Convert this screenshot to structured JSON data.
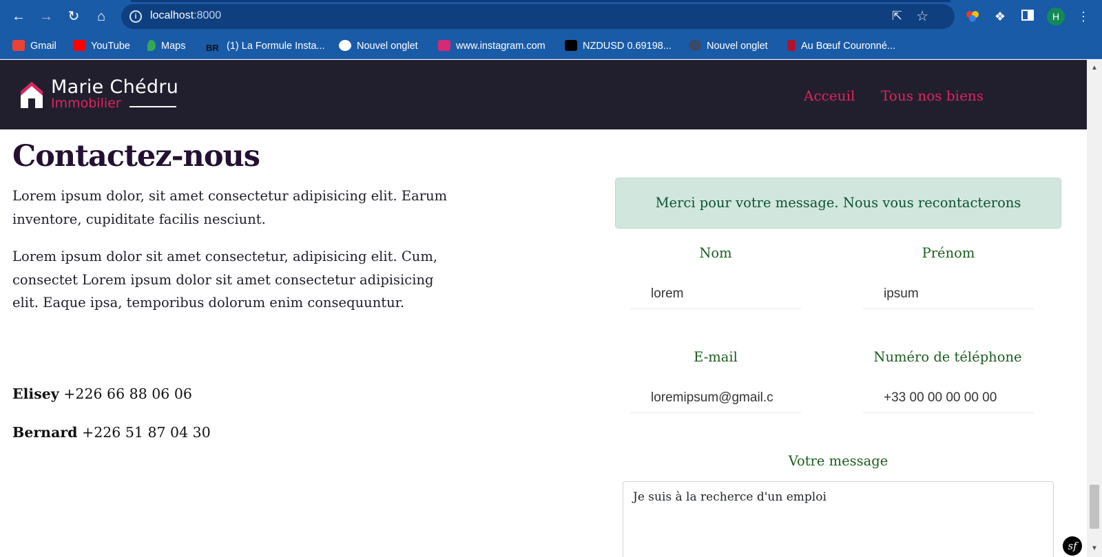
{
  "browser": {
    "url_host": "localhost",
    "url_port": ":8000",
    "profile_initial": "H",
    "bookmarks": [
      {
        "label": "Gmail",
        "icon": "gmail-icon",
        "color": "#ea4335"
      },
      {
        "label": "YouTube",
        "icon": "youtube-icon",
        "color": "#ff0000"
      },
      {
        "label": "Maps",
        "icon": "maps-icon",
        "color": "#34a853"
      },
      {
        "label": "(1) La Formule Insta...",
        "icon": "br-icon",
        "color": "#111111"
      },
      {
        "label": "Nouvel onglet",
        "icon": "globe-icon",
        "color": "#ffffff"
      },
      {
        "label": "www.instagram.com",
        "icon": "instagram-icon",
        "color": "#d62976"
      },
      {
        "label": "NZDUSD 0.69198...",
        "icon": "tradingview-icon",
        "color": "#000000"
      },
      {
        "label": "Nouvel onglet",
        "icon": "page-icon",
        "color": "#3a4a66"
      },
      {
        "label": "Au Bœuf Couronné...",
        "icon": "bull-icon",
        "color": "#b3122b"
      }
    ]
  },
  "header": {
    "logo_name": "Marie Chédru",
    "logo_sub": "Immobilier",
    "nav": [
      "Acceuil",
      "Tous nos biens"
    ],
    "accent": "#e0245e",
    "background": "#211f2d"
  },
  "main": {
    "title": "Contactez-nous",
    "paragraphs": [
      "Lorem ipsum dolor, sit amet consectetur adipisicing elit. Earum inventore, cupiditate facilis nesciunt.",
      "Lorem ipsum dolor sit amet consectetur, adipisicing elit. Cum, consectet Lorem ipsum dolor sit amet consectetur adipisicing elit. Eaque ipsa, temporibus dolorum enim consequuntur."
    ],
    "contacts": [
      {
        "name": "Elisey",
        "phone": "+226 66 88 06 06"
      },
      {
        "name": "Bernard",
        "phone": "+226 51 87 04 30"
      }
    ]
  },
  "form": {
    "success_message": "Merci pour votre message. Nous vous recontacterons",
    "fields": {
      "nom": {
        "label": "Nom",
        "value": "lorem"
      },
      "prenom": {
        "label": "Prénom",
        "value": "ipsum"
      },
      "email": {
        "label": "E-mail",
        "value": "loremipsum@gmail.c"
      },
      "telephone": {
        "label": "Numéro de téléphone",
        "value": "+33 00 00 00 00 00"
      }
    },
    "message_label": "Votre message",
    "message_value": "Je suis à la recherce d'un emploi"
  },
  "symfony_badge": "sf"
}
